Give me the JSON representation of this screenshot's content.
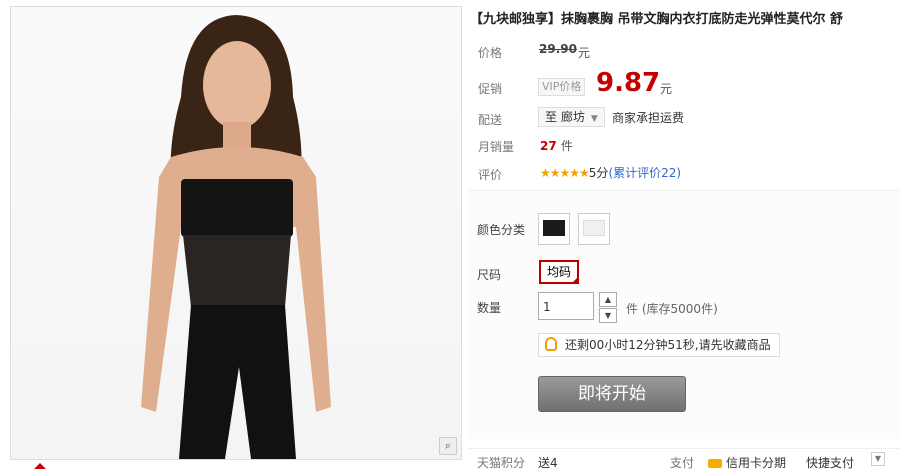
{
  "product": {
    "title": "【九块邮独享】抹胸裹胸 吊带文胸内衣打底防走光弹性莫代尔 舒"
  },
  "price": {
    "label": "价格",
    "original": "29.90",
    "currency": "元"
  },
  "promo": {
    "label": "促销",
    "vip_tag": "VIP价格",
    "price": "9.87",
    "currency": "元"
  },
  "shipping": {
    "label": "配送",
    "to": "至 廊坊",
    "note": "商家承担运费"
  },
  "monthly_sales": {
    "label": "月销量",
    "count": "27",
    "unit": "件"
  },
  "rating": {
    "label": "评价",
    "stars": "★★★★★",
    "score": "5分",
    "link": "(累计评价22)"
  },
  "options": {
    "color_label": "颜色分类",
    "colors": [
      "black",
      "white"
    ],
    "size_label": "尺码",
    "size_value": "均码",
    "qty_label": "数量",
    "qty_value": "1",
    "stock_unit": "件",
    "stock_text": "(库存5000件)",
    "notice": "还剩00小时12分钟51秒,请先收藏商品"
  },
  "buy_button": "即将开始",
  "bottom": {
    "points_label": "天猫积分",
    "points_value": "送4",
    "pay_label": "支付",
    "installment": "信用卡分期",
    "quick_pay": "快捷支付"
  },
  "colors": {
    "accent_red": "#c40000",
    "star_orange": "#f5a000",
    "link_blue": "#3366cc"
  }
}
